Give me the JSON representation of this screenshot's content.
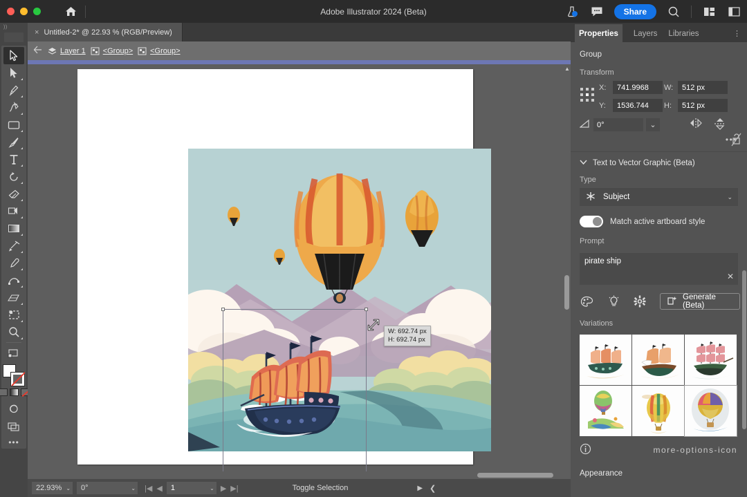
{
  "titlebar": {
    "app_title": "Adobe Illustrator 2024 (Beta)",
    "share_label": "Share",
    "home_icon": "home-icon",
    "flask_icon": "beta-flask-icon",
    "comment_icon": "comment-icon",
    "search_icon": "search-icon",
    "arrange_icon": "arrange-documents-icon",
    "workspace_icon": "workspace-switcher-icon"
  },
  "document_tab": {
    "close": "×",
    "title": "Untitled-2* @ 22.93 % (RGB/Preview)"
  },
  "breadcrumb": {
    "back_icon": "back-arrow-icon",
    "items": [
      {
        "icon": "layers-icon",
        "label": "Layer 1"
      },
      {
        "icon": "group-icon",
        "label": "<Group>"
      },
      {
        "icon": "group-icon",
        "label": "<Group>"
      }
    ]
  },
  "toolbar": {
    "tools": [
      {
        "name": "selection-tool",
        "label": "Selection"
      },
      {
        "name": "direct-selection-tool",
        "label": "Direct Selection"
      },
      {
        "name": "pen-tool",
        "label": "Pen"
      },
      {
        "name": "curvature-tool",
        "label": "Curvature"
      },
      {
        "name": "rectangle-tool",
        "label": "Rectangle"
      },
      {
        "name": "paintbrush-tool",
        "label": "Paintbrush"
      },
      {
        "name": "type-tool",
        "label": "Type"
      },
      {
        "name": "rotate-tool",
        "label": "Rotate"
      },
      {
        "name": "eraser-tool",
        "label": "Eraser"
      },
      {
        "name": "shape-builder-tool",
        "label": "Shape Builder"
      },
      {
        "name": "gradient-tool",
        "label": "Gradient"
      },
      {
        "name": "width-tool",
        "label": "Width"
      },
      {
        "name": "eyedropper-tool",
        "label": "Eyedropper"
      },
      {
        "name": "free-transform-tool",
        "label": "Free Transform"
      },
      {
        "name": "perspective-grid-tool",
        "label": "Perspective Grid"
      },
      {
        "name": "artboard-tool",
        "label": "Artboard"
      },
      {
        "name": "zoom-tool",
        "label": "Zoom"
      },
      {
        "name": "screen-mode-tool",
        "label": "Change Screen Mode"
      }
    ],
    "more_label": "•••"
  },
  "canvas": {
    "selection_tooltip": {
      "width_line": "W: 692.74 px",
      "height_line": "H: 692.74 px"
    },
    "artwork_alt": "hot-air-balloons-over-river-with-pirate-ship"
  },
  "statusbar": {
    "zoom_level": "22.93%",
    "rotation": "0°",
    "artboard_number": "1",
    "mode_label": "Toggle Selection",
    "caret": "⌄"
  },
  "properties_panel": {
    "tabs": [
      {
        "label": "Properties",
        "active": true
      },
      {
        "label": "Layers",
        "active": false
      },
      {
        "label": "Libraries",
        "active": false
      }
    ],
    "menu_icon": "panel-menu-icon",
    "selection_title": "Group",
    "transform": {
      "section_label": "Transform",
      "x_label": "X:",
      "x_value": "741.9968",
      "y_label": "Y:",
      "y_value": "1536.744",
      "w_label": "W:",
      "w_value": "512 px",
      "h_label": "H:",
      "h_value": "512 px",
      "angle_label": "angle-icon",
      "angle_value": "0°",
      "constrain_icon": "link-broken-icon",
      "flip_horizontal_icon": "flip-horizontal-icon",
      "flip_vertical_icon": "flip-vertical-icon",
      "more_options": "•••"
    },
    "text_to_vector": {
      "header": "Text to Vector Graphic (Beta)",
      "disclosure_icon": "chevron-down-icon",
      "type_label": "Type",
      "type_value": "Subject",
      "type_icon": "subject-icon",
      "type_caret": "chevron-down-icon",
      "match_style_label": "Match active artboard style",
      "match_style_on": true,
      "prompt_label": "Prompt",
      "prompt_value": "pirate ship",
      "prompt_clear_icon": "clear-x-icon",
      "action_icons": [
        "palette-icon",
        "lightbulb-icon",
        "settings-gear-icon"
      ],
      "generate_label": "Generate (Beta)",
      "generate_icon": "generate-icon",
      "variations_label": "Variations",
      "variations": [
        {
          "name": "variation-1",
          "alt": "orange-sailed-pirate-ship",
          "selected": false
        },
        {
          "name": "variation-2",
          "alt": "tan-sailed-galleon",
          "selected": false
        },
        {
          "name": "variation-3",
          "alt": "pink-sailed-tall-ship",
          "selected": false
        },
        {
          "name": "variation-4",
          "alt": "balloon-over-green-landscape",
          "selected": false
        },
        {
          "name": "variation-5",
          "alt": "striped-hot-air-balloon",
          "selected": false
        },
        {
          "name": "variation-6",
          "alt": "rainbow-balloon-in-oval",
          "selected": true
        }
      ],
      "info_icon": "info-icon",
      "more_icon": "more-options-icon"
    },
    "appearance_label": "Appearance"
  },
  "colors": {
    "accent_blue": "#1473e6",
    "panel_bg": "#535353",
    "titlebar_bg": "#2b2b2b",
    "canvas_bg": "#5e5e5e",
    "field_bg": "#404040",
    "breadcrumb_bg": "#6e6e6e",
    "rule_blue": "#6d77b4"
  }
}
